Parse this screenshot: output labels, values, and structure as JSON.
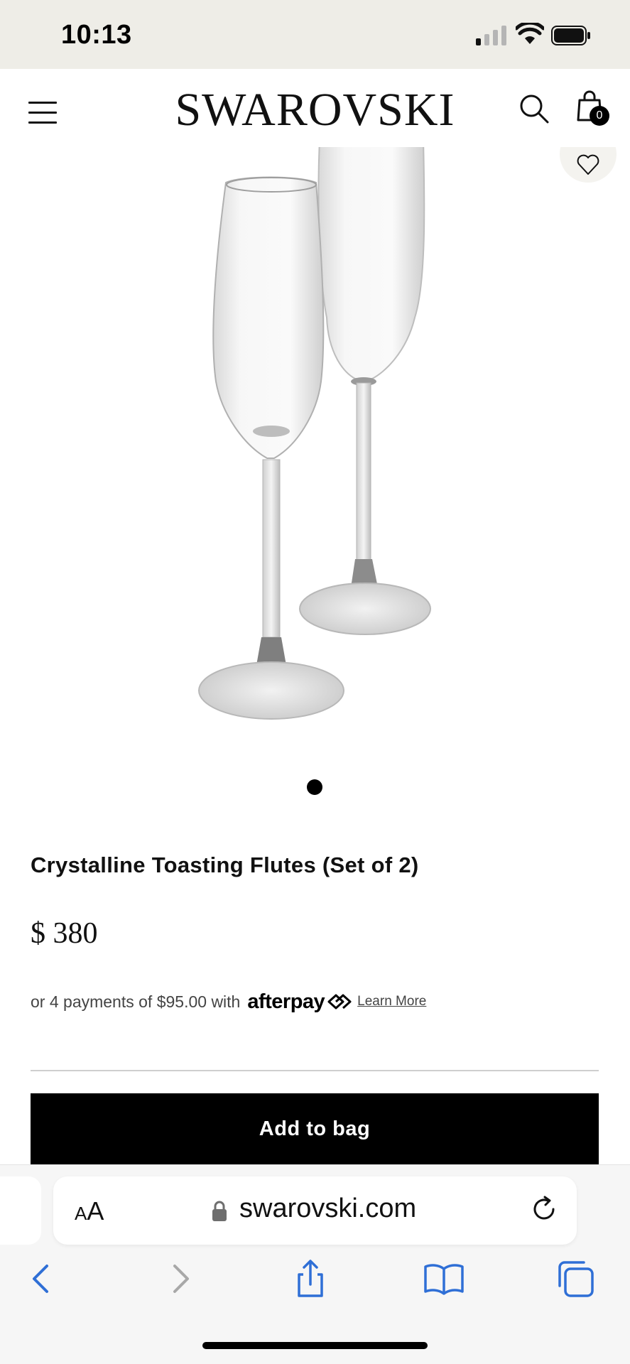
{
  "status_bar": {
    "time": "10:13"
  },
  "header": {
    "logo": "SWAROVSKI",
    "bag_count": "0"
  },
  "product": {
    "title": "Crystalline Toasting Flutes (Set of 2)",
    "price": "$ 380",
    "installment_text": "or 4 payments of $95.00 with",
    "afterpay_brand": "afterpay",
    "learn_more": "Learn More",
    "add_to_bag": "Add to bag"
  },
  "carousel": {
    "total_images": 1,
    "active_index": 0
  },
  "browser": {
    "text_size_small": "A",
    "text_size_large": "A",
    "url": "swarovski.com"
  },
  "colors": {
    "status_bar_bg": "#eeede7",
    "button_bg": "#000000",
    "browser_accent": "#2f6fd6"
  },
  "icons": [
    "signal-icon",
    "wifi-icon",
    "battery-icon",
    "menu-icon",
    "search-icon",
    "bag-icon",
    "heart-icon",
    "lock-icon",
    "reload-icon",
    "back-icon",
    "forward-icon",
    "share-icon",
    "bookmarks-icon",
    "tabs-icon"
  ]
}
